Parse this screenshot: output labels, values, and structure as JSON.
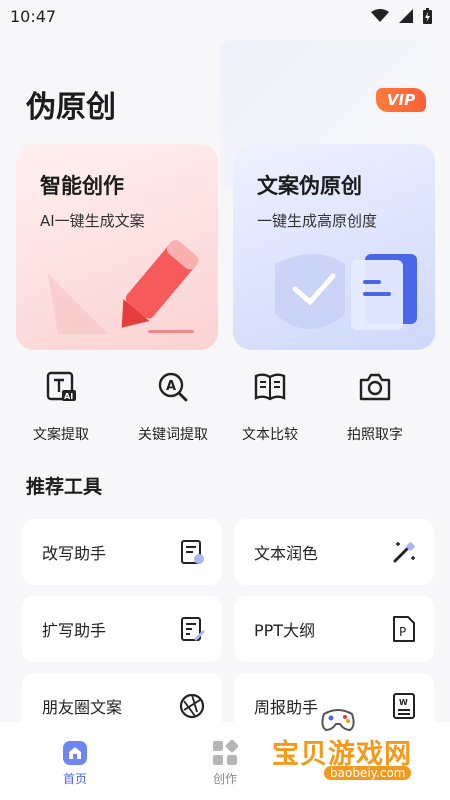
{
  "status_bar": {
    "time": "10:47"
  },
  "header": {
    "title": "伪原创",
    "vip": "VIP"
  },
  "cards": [
    {
      "title": "智能创作",
      "subtitle": "AI一键生成文案"
    },
    {
      "title": "文案伪原创",
      "subtitle": "一键生成高原创度"
    }
  ],
  "quick_actions": [
    {
      "label": "文案提取",
      "icon": "text-ai-icon"
    },
    {
      "label": "关键词提取",
      "icon": "search-a-icon"
    },
    {
      "label": "文本比较",
      "icon": "book-icon"
    },
    {
      "label": "拍照取字",
      "icon": "camera-icon"
    }
  ],
  "section": {
    "title": "推荐工具"
  },
  "tools": [
    {
      "label": "改写助手",
      "icon": "edit-doc-icon"
    },
    {
      "label": "文本润色",
      "icon": "magic-wand-icon"
    },
    {
      "label": "扩写助手",
      "icon": "expand-doc-icon"
    },
    {
      "label": "PPT大纲",
      "icon": "ppt-file-icon"
    },
    {
      "label": "朋友圈文案",
      "icon": "aperture-icon"
    },
    {
      "label": "周报助手",
      "icon": "word-doc-icon"
    }
  ],
  "bottom_nav": [
    {
      "label": "首页",
      "active": true
    },
    {
      "label": "创作",
      "active": false
    }
  ],
  "watermark": {
    "text": "宝贝游戏网",
    "domain": "baobeiy.com"
  },
  "colors": {
    "accent": "#4a67e8",
    "vip": "#ff6a3a",
    "watermark": "#f39a1c"
  }
}
